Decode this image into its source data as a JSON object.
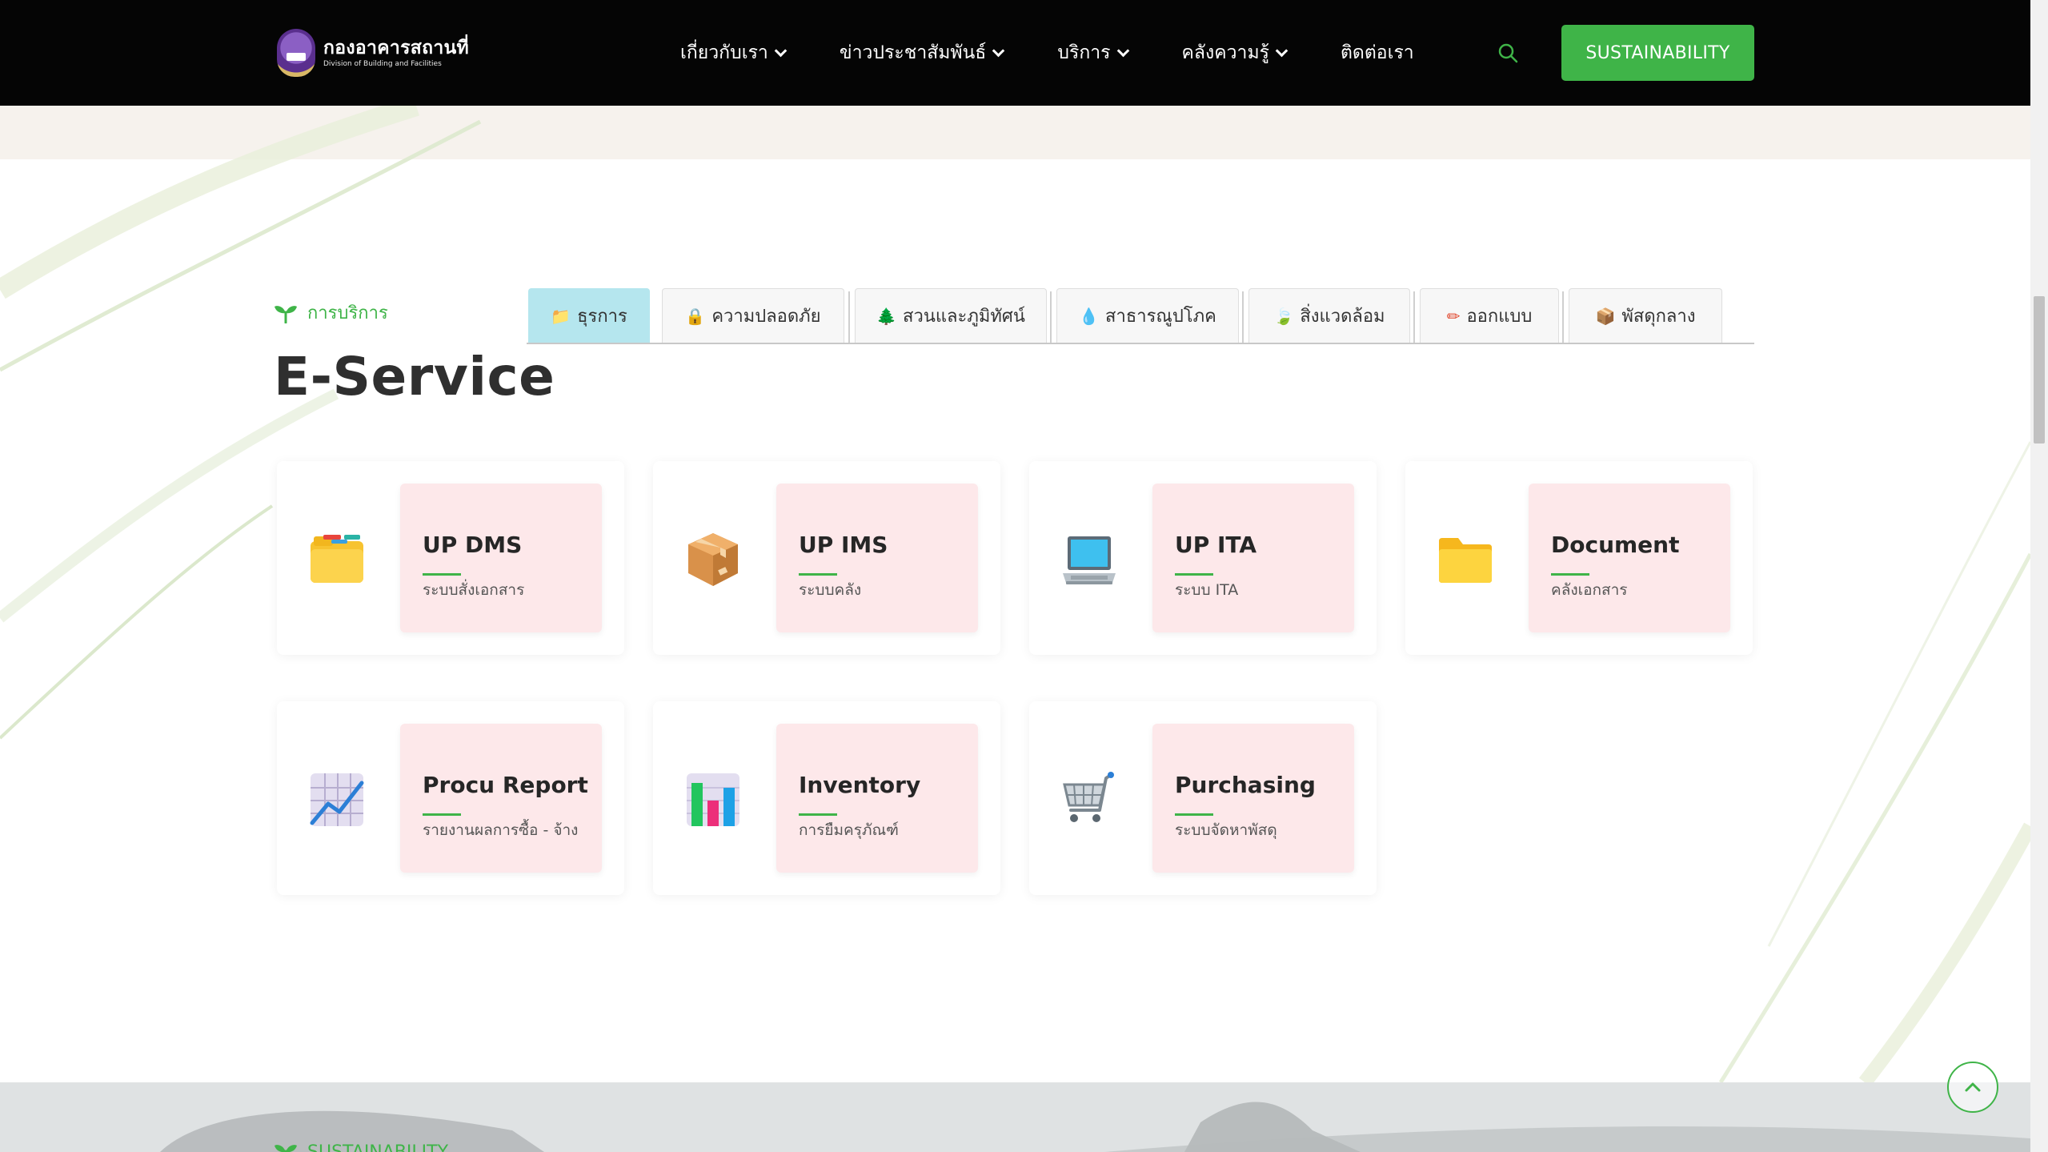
{
  "header": {
    "logo_th": "กองอาคารสถานที่",
    "logo_en": "Division of Building and Facilities",
    "nav": [
      {
        "label": "เกี่ยวกับเรา",
        "dropdown": true
      },
      {
        "label": "ข่าวประชาสัมพันธ์",
        "dropdown": true
      },
      {
        "label": "บริการ",
        "dropdown": true
      },
      {
        "label": "คลังความรู้",
        "dropdown": true
      },
      {
        "label": "ติดต่อเรา",
        "dropdown": false
      }
    ],
    "search_icon": "search-icon",
    "cta_label": "SUSTAINABILITY"
  },
  "colors": {
    "header_bg": "#050505",
    "accent_green": "#3fb448",
    "active_tab": "#b5e6ee",
    "card_panel": "#fde8ea"
  },
  "eservice": {
    "label": "การบริการ",
    "title": "E-Service",
    "tabs": [
      {
        "label": "ธุรการ",
        "icon": "folder-icon",
        "glyph": "📁",
        "active": true
      },
      {
        "label": "ความปลอดภัย",
        "icon": "lock-icon",
        "glyph": "🔒",
        "active": false
      },
      {
        "label": "สวนและภูมิทัศน์",
        "icon": "tree-icon",
        "glyph": "🌲",
        "active": false
      },
      {
        "label": "สาธารณูปโภค",
        "icon": "water-drop-icon",
        "glyph": "💧",
        "active": false
      },
      {
        "label": "สิ่งแวดล้อม",
        "icon": "leaf-icon",
        "glyph": "🍃",
        "active": false
      },
      {
        "label": "ออกแบบ",
        "icon": "pencil-icon",
        "glyph": "✏",
        "active": false
      },
      {
        "label": "พัสดุกลาง",
        "icon": "package-icon",
        "glyph": "📦",
        "active": false
      }
    ],
    "cards": [
      {
        "title": "UP DMS",
        "subtitle": "ระบบสั่งเอกสาร",
        "icon": "card-index-folder-icon"
      },
      {
        "title": "UP IMS",
        "subtitle": "ระบบคลัง",
        "icon": "package-icon"
      },
      {
        "title": "UP ITA",
        "subtitle": "ระบบ ITA",
        "icon": "laptop-icon"
      },
      {
        "title": "Document",
        "subtitle": "คลังเอกสาร",
        "icon": "folder-icon"
      },
      {
        "title": "Procu Report",
        "subtitle": "รายงานผลการซื้อ - จ้าง",
        "icon": "chart-increasing-icon"
      },
      {
        "title": "Inventory",
        "subtitle": "การยืมครุภัณฑ์",
        "icon": "bar-chart-icon"
      },
      {
        "title": "Purchasing",
        "subtitle": "ระบบจัดหาพัสดุ",
        "icon": "shopping-cart-icon"
      }
    ]
  },
  "bottom": {
    "label": "SUSTAINABILITY",
    "back_to_top_icon": "chevron-up-icon"
  }
}
